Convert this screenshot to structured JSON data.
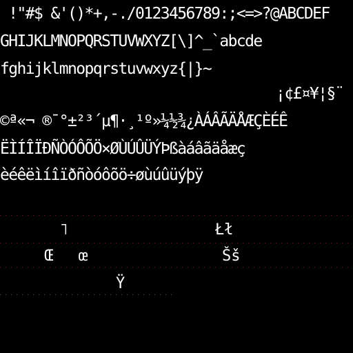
{
  "glyph_rows": [
    " !\"#$ &'()*+,-./0123456789:;<=>?@ABCDEF",
    "GHIJKLMNOPQRSTUVWXYZ[\\]^_`abcde",
    "fghijklmnopqrstuvwxyz{|}~",
    "¡¢£¤¥¦§¨",
    "©ª«¬ ®¯°±²³´µ¶·¸¹º»¼½¾¿ÀÁÂÃÄÅÆÇÈÉÊ",
    "ËÌÍÎÏÐÑÒÓÔÕÖ×ØÙÚÛÜÝÞßàáâãäåæç",
    "èéêëìíîïðñòóôõö÷øùúûüýþÿ"
  ],
  "extended_cells": [
    {
      "id": "not-sign",
      "text": "˥"
    },
    {
      "id": "l-stroke",
      "text": "Łł"
    },
    {
      "id": "oe-upper",
      "text": "Œ"
    },
    {
      "id": "oe-lower",
      "text": "œ"
    },
    {
      "id": "s-caron",
      "text": "Šš"
    },
    {
      "id": "y-diaeresis",
      "text": "Ÿ"
    }
  ],
  "colors": {
    "background": "#000000",
    "glyph": "#ffffff",
    "grid_dots": "#7a1a1a"
  }
}
